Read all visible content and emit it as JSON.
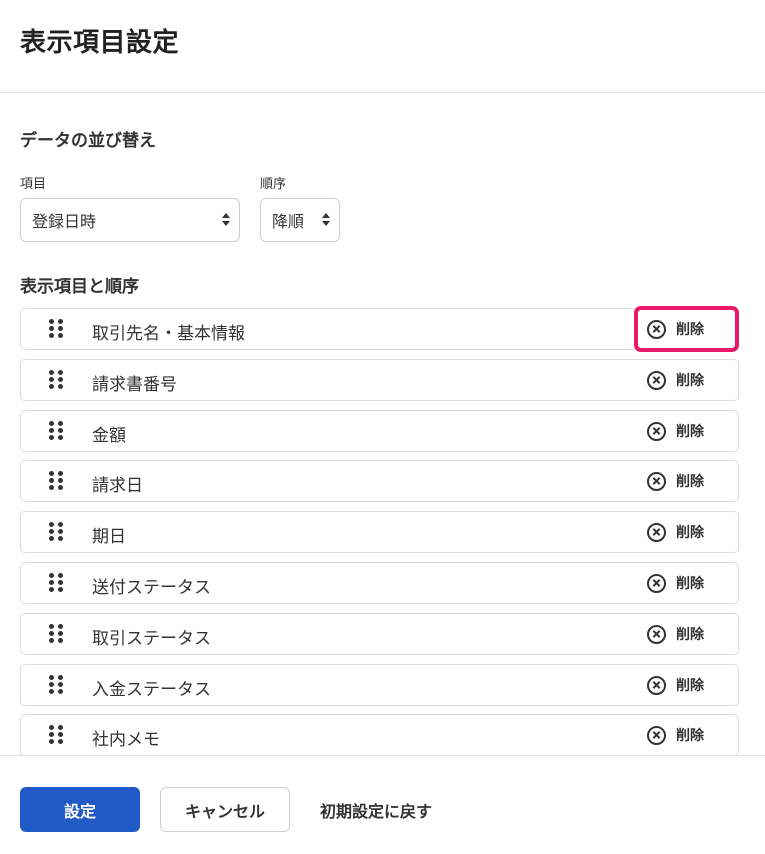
{
  "page": {
    "title": "表示項目設定"
  },
  "sort": {
    "section_title": "データの並び替え",
    "item_label": "項目",
    "item_value": "登録日時",
    "order_label": "順序",
    "order_value": "降順"
  },
  "columns": {
    "section_title": "表示項目と順序",
    "delete_label": "削除",
    "items": [
      {
        "label": "取引先名・基本情報"
      },
      {
        "label": "請求書番号"
      },
      {
        "label": "金額"
      },
      {
        "label": "請求日"
      },
      {
        "label": "期日"
      },
      {
        "label": "送付ステータス"
      },
      {
        "label": "取引ステータス"
      },
      {
        "label": "入金ステータス"
      },
      {
        "label": "社内メモ"
      }
    ]
  },
  "footer": {
    "submit_label": "設定",
    "cancel_label": "キャンセル",
    "reset_label": "初期設定に戻す"
  },
  "colors": {
    "primary": "#2159c7",
    "highlight": "#e8196b"
  }
}
